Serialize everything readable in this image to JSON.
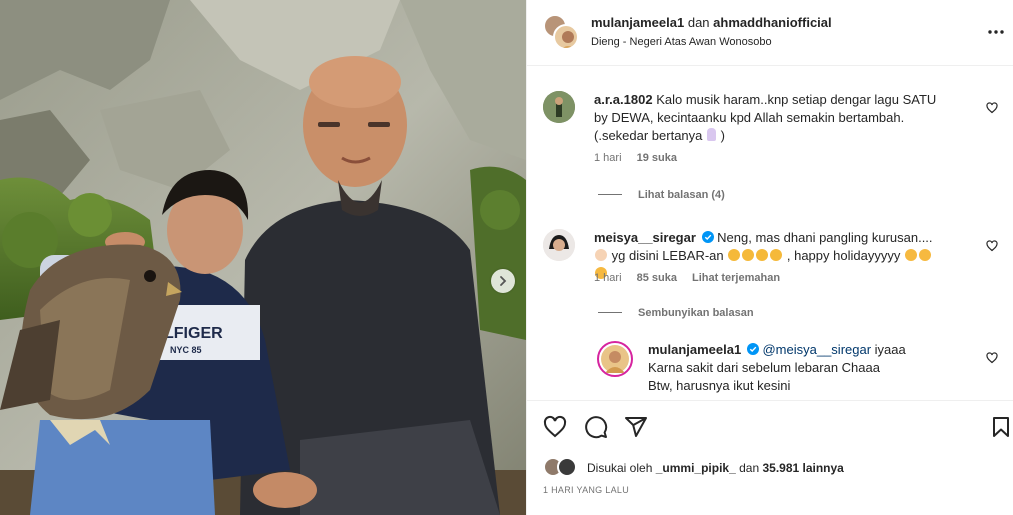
{
  "post": {
    "author_1": "mulanjameela1",
    "connector": "dan",
    "author_2": "ahmaddhaniofficial",
    "location": "Dieng - Negeri Atas Awan Wonosobo",
    "photo_description": "photo",
    "tshirt_text_1": "HILFIGER",
    "tshirt_text_2": "NYC 85"
  },
  "comments": [
    {
      "username": "a.r.a.1802",
      "text": "Kalo musik haram..knp setiap dengar lagu SATU by DEWA, kecintaanku kpd Allah semakin bertambah.(.sekedar bertanya",
      "text_end": ")",
      "time": "1 hari",
      "likes": "19 suka",
      "replies_toggle": "Lihat balasan (4)"
    },
    {
      "username": "meisya__siregar",
      "text_a": "Neng, mas dhani pangling kurusan....",
      "text_b": "yg disini LEBAR-an",
      "text_c": ", happy holidayyyyy",
      "time": "1 hari",
      "likes": "85 suka",
      "translate": "Lihat terjemahan",
      "replies_toggle": "Sembunyikan balasan"
    },
    {
      "username": "mulanjameela1",
      "mention": "@meisya__siregar",
      "text_1": "iyaaa",
      "text_2": "Karna sakit dari sebelum lebaran Chaaa",
      "text_3": "Btw, harusnya ikut kesini"
    }
  ],
  "footer": {
    "liked_by_prefix": "Disukai oleh",
    "liked_by_user": "_ummi_pipik_",
    "liked_by_and": "dan",
    "liked_by_count": "35.981 lainnya",
    "posted_time": "1 HARI YANG LALU"
  },
  "icons": [
    "more-icon",
    "heart-icon",
    "comment-icon",
    "share-icon",
    "bookmark-icon",
    "chevron-right-icon",
    "verified-badge-icon"
  ],
  "colors": {
    "text": "#262626",
    "muted": "#737373",
    "link": "#00376b",
    "verified": "#0095f6",
    "border": "#efefef"
  }
}
